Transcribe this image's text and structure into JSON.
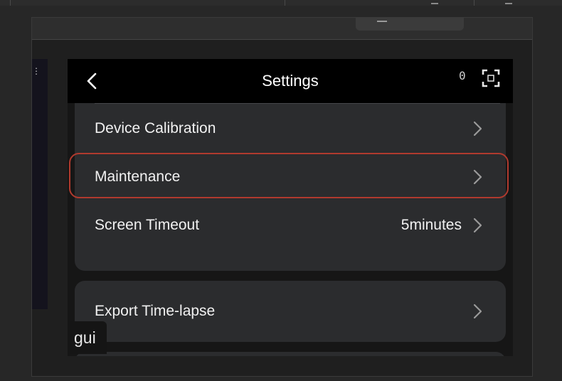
{
  "app_bar": {
    "title": "Settings",
    "counter": "0",
    "back_icon": "chevron-left-icon",
    "fullscreen_icon": "fullscreen-icon"
  },
  "settings": {
    "rows": [
      {
        "label": "Device Calibration",
        "value": ""
      },
      {
        "label": "Maintenance",
        "value": ""
      },
      {
        "label": "Screen Timeout",
        "value": "5minutes"
      }
    ],
    "export_row": {
      "label": "Export Time-lapse"
    }
  },
  "overlay_tag": "gui",
  "colors": {
    "background": "#272727",
    "card": "#2b2c2e",
    "app_bar": "#000000",
    "highlight": "#b03a2e",
    "text": "#f1f1f1"
  }
}
